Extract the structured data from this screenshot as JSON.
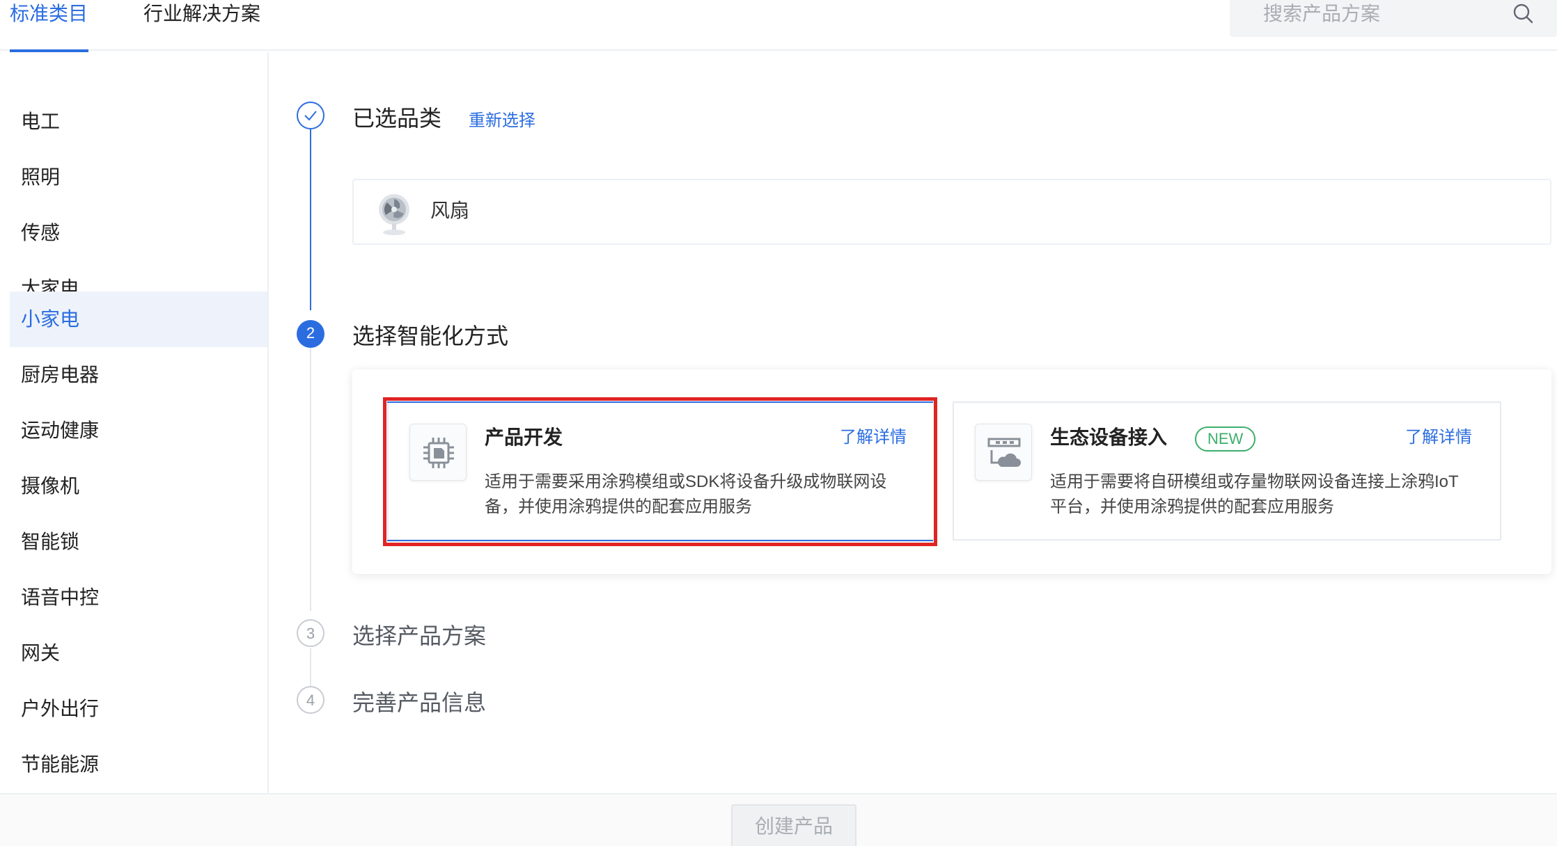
{
  "tabs": [
    {
      "label": "标准类目",
      "active": true
    },
    {
      "label": "行业解决方案",
      "active": false
    }
  ],
  "search": {
    "placeholder": "搜索产品方案",
    "icon": "search-icon"
  },
  "sidebar": {
    "items": [
      {
        "label": "电工"
      },
      {
        "label": "照明"
      },
      {
        "label": "传感"
      },
      {
        "label": "大家电"
      },
      {
        "label": "小家电",
        "active": true
      },
      {
        "label": "厨房电器"
      },
      {
        "label": "运动健康"
      },
      {
        "label": "摄像机"
      },
      {
        "label": "智能锁"
      },
      {
        "label": "语音中控"
      },
      {
        "label": "网关"
      },
      {
        "label": "户外出行"
      },
      {
        "label": "节能能源"
      }
    ]
  },
  "steps": [
    {
      "number": "1",
      "state": "done",
      "title": "已选品类",
      "action": "重新选择"
    },
    {
      "number": "2",
      "state": "current",
      "title": "选择智能化方式"
    },
    {
      "number": "3",
      "state": "pending",
      "title": "选择产品方案"
    },
    {
      "number": "4",
      "state": "pending",
      "title": "完善产品信息"
    }
  ],
  "selected_category": {
    "name": "风扇",
    "icon": "fan-icon"
  },
  "options": [
    {
      "title": "产品开发",
      "link": "了解详情",
      "description": "适用于需要采用涂鸦模组或SDK将设备升级成物联网设备，并使用涂鸦提供的配套应用服务",
      "icon": "chip-icon",
      "highlighted": true
    },
    {
      "title": "生态设备接入",
      "badge": "NEW",
      "link": "了解详情",
      "description": "适用于需要将自研模组或存量物联网设备连接上涂鸦IoT平台，并使用涂鸦提供的配套应用服务",
      "icon": "cloud-device-icon"
    }
  ],
  "footer": {
    "create_button": "创建产品"
  },
  "colors": {
    "accent": "#2b6de0",
    "badge_green": "#3dae6b",
    "highlight_red": "#e02424"
  }
}
